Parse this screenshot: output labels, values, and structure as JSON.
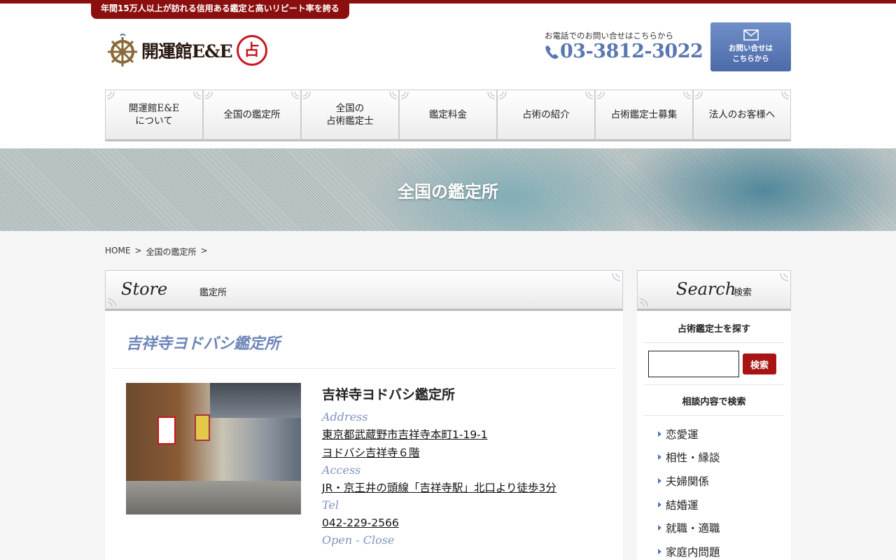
{
  "header": {
    "tagline": "年間15万人以上が訪れる信用ある鑑定と高いリピート率を誇る",
    "logo_text": "開運館E&E",
    "logo_seal": "占",
    "tel_caption": "お電話でのお問い合せはこちらから",
    "tel_number": "03-3812-3022",
    "contact_line1": "お問い合せは",
    "contact_line2": "こちらから"
  },
  "nav": [
    {
      "label": "開運館E&E\nについて"
    },
    {
      "label": "全国の鑑定所"
    },
    {
      "label": "全国の\n占術鑑定士"
    },
    {
      "label": "鑑定料金"
    },
    {
      "label": "占術の紹介"
    },
    {
      "label": "占術鑑定士募集"
    },
    {
      "label": "法人のお客様へ"
    }
  ],
  "hero": {
    "title": "全国の鑑定所"
  },
  "breadcrumb": {
    "home": "HOME",
    "sep1": ">",
    "current": "全国の鑑定所",
    "sep2": ">"
  },
  "main": {
    "head_en": "Store",
    "head_jp": "鑑定所",
    "store_title": "吉祥寺ヨドバシ鑑定所",
    "store_name": "吉祥寺ヨドバシ鑑定所",
    "address_label": "Address",
    "address_line1": "東京都武蔵野市吉祥寺本町1-19-1",
    "address_line2": "ヨドバシ吉祥寺６階",
    "access_label": "Access",
    "access_value": "JR・京王井の頭線「吉祥寺駅」北口より徒歩3分",
    "tel_label": "Tel",
    "tel_value": "042-229-2566",
    "open_label": "Open - Close"
  },
  "sidebar": {
    "head_en": "Search",
    "head_jp": "検索",
    "find_title": "占術鑑定士を探す",
    "search_button": "検索",
    "search_value": "",
    "consult_title": "相談内容で検索",
    "categories": [
      "恋愛運",
      "相性・縁談",
      "夫婦関係",
      "結婚運",
      "就職・適職",
      "家庭内問題"
    ]
  },
  "colors": {
    "brand_red": "#8b0f0f",
    "accent_blue": "#5a77b0",
    "button_red": "#a81414"
  }
}
